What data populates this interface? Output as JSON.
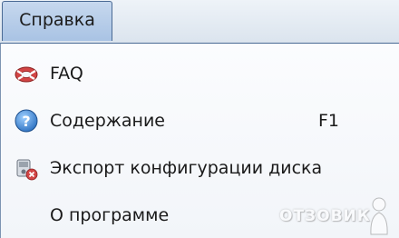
{
  "menubar": {
    "active_menu": "Справка"
  },
  "menu": {
    "items": [
      {
        "label": "FAQ",
        "icon": "lifebuoy-icon"
      },
      {
        "label": "Содержание",
        "shortcut": "F1",
        "icon": "help-icon"
      },
      {
        "label": "Экспорт конфигурации диска",
        "icon": "disk-export-icon"
      },
      {
        "label": "О программе"
      }
    ]
  },
  "watermark": {
    "text": "ОТЗОВИК"
  },
  "colors": {
    "accent_border": "#4a6a94",
    "menu_highlight": "#b7cdea",
    "lifebuoy_red": "#d24545",
    "help_blue": "#3f8fd8"
  }
}
